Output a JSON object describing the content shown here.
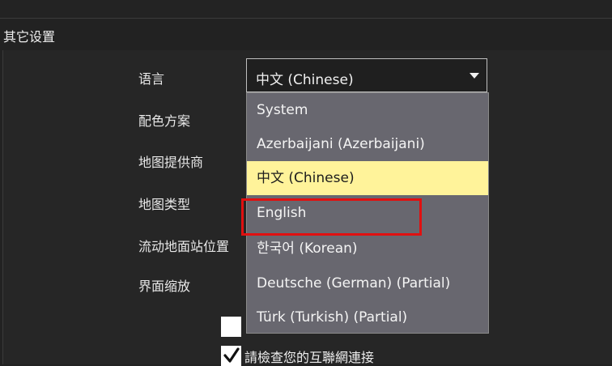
{
  "section": {
    "title": "其它设置"
  },
  "settings": {
    "labels": [
      "语言",
      "配色方案",
      "地图提供商",
      "地图类型",
      "流动地面站位置",
      "界面缩放"
    ]
  },
  "language_combo": {
    "value": "中文 (Chinese)",
    "options": [
      "System",
      "Azerbaijani (Azerbaijani)",
      "中文 (Chinese)",
      "English",
      "한국어 (Korean)",
      "Deutsche (German) (Partial)",
      "Türk (Turkish) (Partial)"
    ],
    "selected_index": 2,
    "highlighted_option": "English"
  },
  "checkboxes": [
    {
      "checked": false,
      "label": ""
    },
    {
      "checked": true,
      "label": "請檢查您的互聯網連接"
    }
  ],
  "colors": {
    "background": "#222222",
    "dropdown_bg": "#68676f",
    "selected_bg": "#fff39a",
    "highlight_border": "#e01010"
  },
  "icons": {
    "combo_arrow": "chevron-down-icon",
    "check": "checkmark-icon"
  }
}
